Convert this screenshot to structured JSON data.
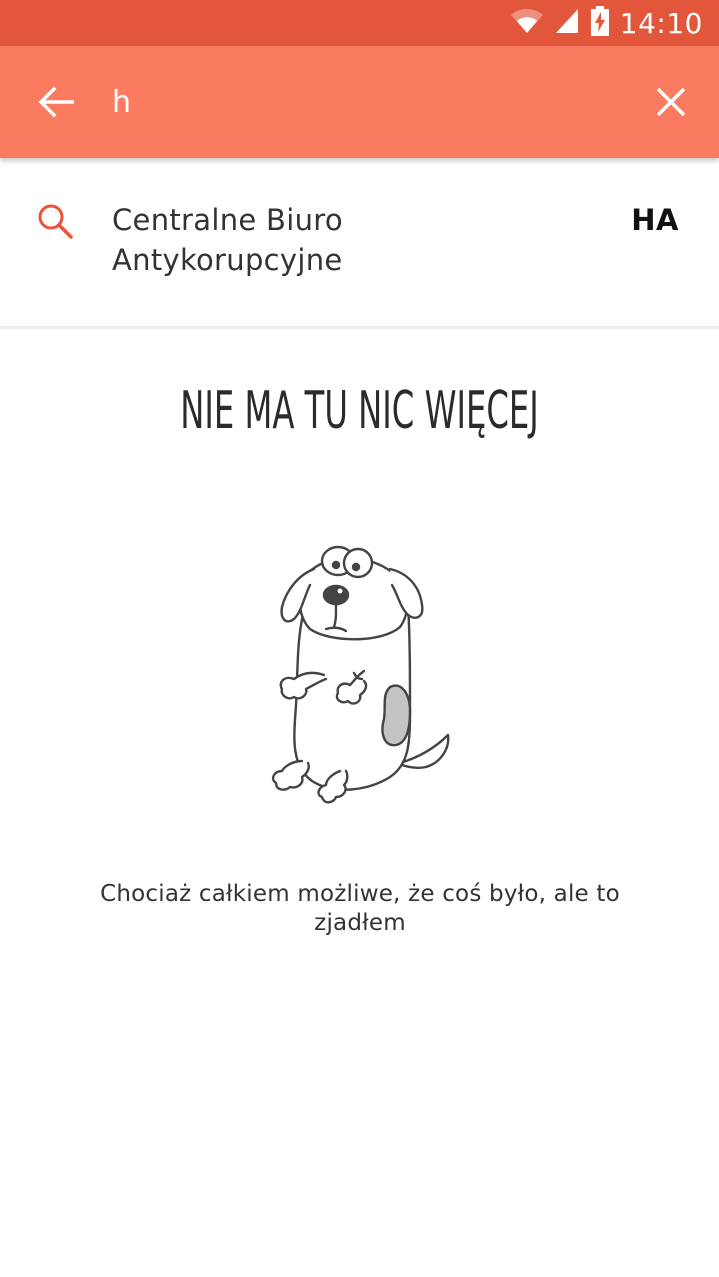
{
  "status_bar": {
    "time": "14:10",
    "icons": [
      "wifi-icon",
      "signal-icon",
      "battery-charging-icon"
    ],
    "background": "#e2573b"
  },
  "search": {
    "query": "h",
    "background": "#fb7b61",
    "icons": [
      "back-arrow-icon",
      "close-icon"
    ]
  },
  "suggestions": [
    {
      "name": "Centralne Biuro Antykorupcyjne",
      "code": "HA",
      "icon": "search-icon",
      "icon_color": "#e8533a"
    }
  ],
  "empty_state": {
    "title": "NIE MA TU NIC WIĘCEJ",
    "message": "Chociaż całkiem możliwe, że coś było, ale to zjadłem",
    "illustration": "dog-illustration"
  }
}
